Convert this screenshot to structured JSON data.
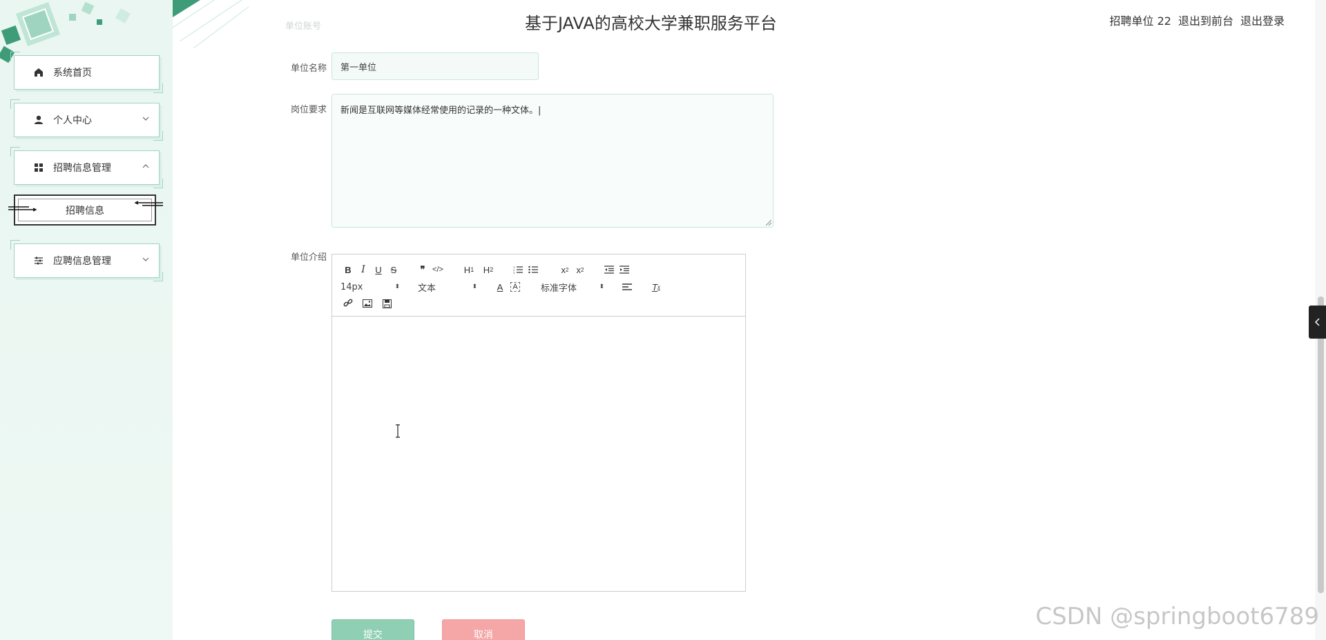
{
  "header": {
    "title": "基于JAVA的高校大学兼职服务平台",
    "user": "招聘单位 22",
    "back_to_front": "退出到前台",
    "logout": "退出登录"
  },
  "sidebar": {
    "items": [
      {
        "label": "系统首页",
        "icon": "home-icon"
      },
      {
        "label": "个人中心",
        "icon": "user-icon"
      },
      {
        "label": "招聘信息管理",
        "icon": "grid-icon"
      },
      {
        "label": "应聘信息管理",
        "icon": "sliders-icon"
      }
    ],
    "submenu": {
      "label": "招聘信息"
    }
  },
  "form": {
    "faded_label": "单位账号",
    "company_name_label": "单位名称",
    "company_name_value": "第一单位",
    "requirements_label": "岗位要求",
    "requirements_value": "新闻是互联网等媒体经常使用的记录的一种文体。|",
    "intro_label": "单位介绍",
    "submit": "提交",
    "cancel": "取消"
  },
  "editor": {
    "font_size": "14px",
    "text_type": "文本",
    "font_family": "标准字体"
  },
  "watermark": "CSDN @springboot6789",
  "colors": {
    "accent": "#8fcfb3",
    "danger": "#f5a7a7",
    "sidebar_bg": "#e9f6f1"
  }
}
